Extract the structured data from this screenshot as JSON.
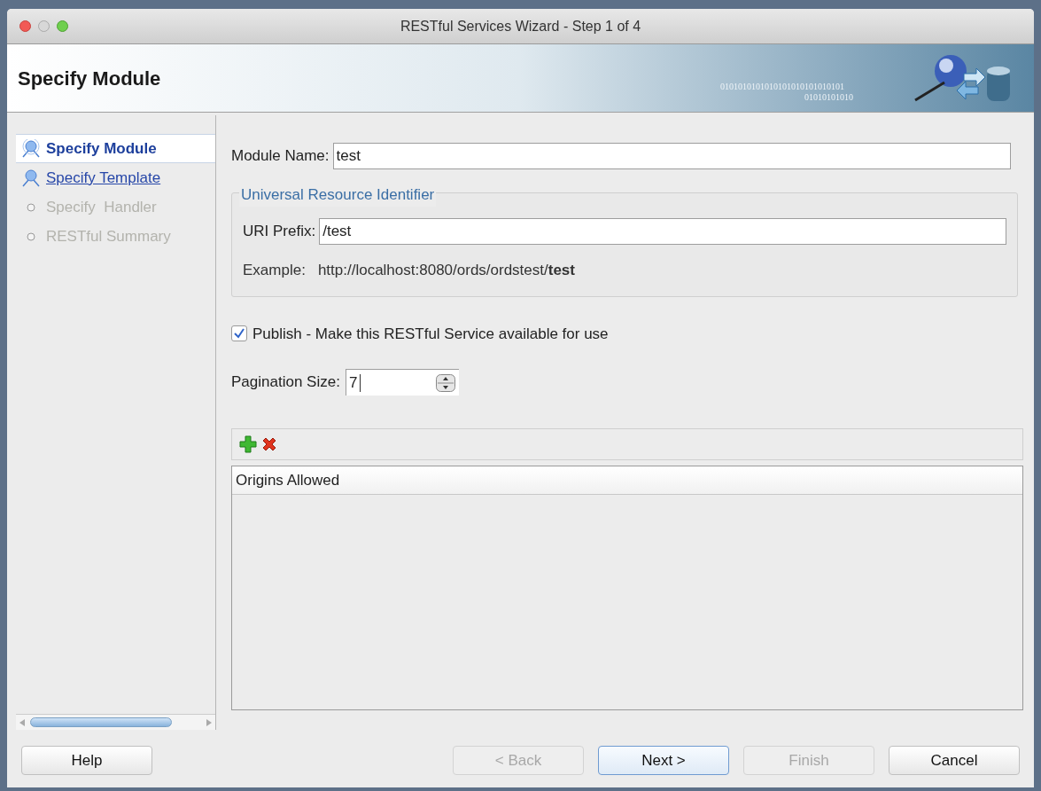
{
  "window": {
    "title": "RESTful Services Wizard - Step 1 of 4"
  },
  "header": {
    "title": "Specify Module",
    "binary_text": "0101010101010101010101010101",
    "binary_text_2": "01010101010"
  },
  "steps": [
    {
      "label": "Specify Module",
      "selected": true,
      "enabled": true
    },
    {
      "label": "Specify Template",
      "selected": false,
      "enabled": true
    },
    {
      "label": "Specify  Handler",
      "selected": false,
      "enabled": false
    },
    {
      "label": "RESTful Summary",
      "selected": false,
      "enabled": false
    }
  ],
  "module_name": {
    "label": "Module Name:",
    "value": "test"
  },
  "uri_group": {
    "title": "Universal Resource Identifier",
    "prefix_label": "URI Prefix:",
    "prefix_value": "/test",
    "example_label": "Example:",
    "example_value": "http://localhost:8080/ords/ordstest/**test**"
  },
  "publish": {
    "label": "Publish - Make this RESTful Service available for use",
    "checked": true
  },
  "pagination": {
    "label": "Pagination Size:",
    "value": "7"
  },
  "origins_table": {
    "columns": [
      "Origins Allowed"
    ]
  },
  "buttons": [
    {
      "label": "Help",
      "enabled": true,
      "default": false
    },
    {
      "label": "< Back",
      "enabled": false,
      "default": false
    },
    {
      "label": "Next >",
      "enabled": true,
      "default": true
    },
    {
      "label": "Finish",
      "enabled": false,
      "default": false
    },
    {
      "label": "Cancel",
      "enabled": true,
      "default": false
    }
  ]
}
